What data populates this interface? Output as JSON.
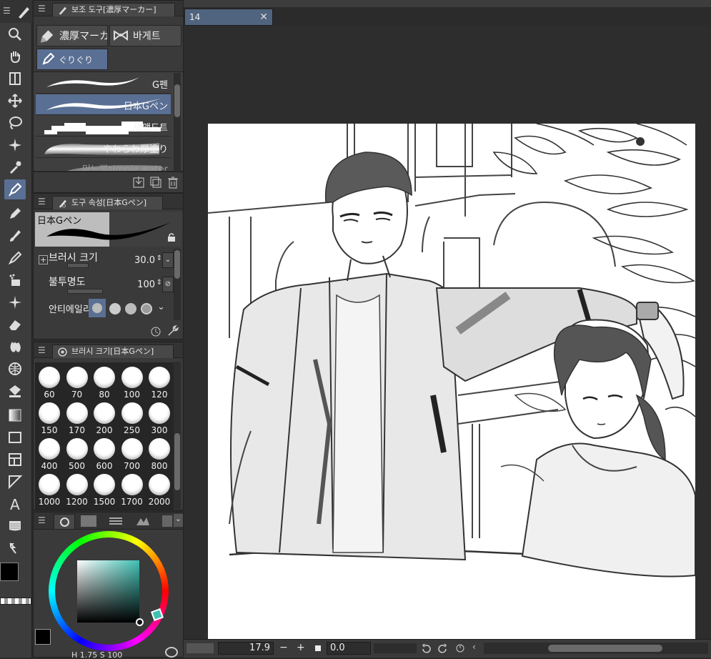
{
  "sub_tool_panel": {
    "title": "보조 도구[濃厚マーカー]",
    "tabs": [
      "濃厚マーカ",
      "바게트"
    ],
    "group_label": "ぐりぐり",
    "brushes": [
      {
        "label": "G펜"
      },
      {
        "label": "日本Gペン"
      },
      {
        "label": "맹맹도트"
      },
      {
        "label": "やわらわ厚塗り"
      },
      {
        "label": "머느뻘simple water"
      }
    ]
  },
  "tool_property_panel": {
    "title": "도구 속성[日本Gペン]",
    "preview_label": "日本Gペン",
    "brush_size_label": "브러시 크기",
    "brush_size_value": "30.0",
    "opacity_label": "불투명도",
    "opacity_value": "100",
    "antialias_label": "안티에일리"
  },
  "brush_size_panel": {
    "title": "브러시 크기[日本Gペン]",
    "sizes": [
      "60",
      "70",
      "80",
      "100",
      "120",
      "150",
      "170",
      "200",
      "250",
      "300",
      "400",
      "500",
      "600",
      "700",
      "800",
      "1000",
      "1200",
      "1500",
      "1700",
      "2000"
    ]
  },
  "color_panel": {
    "color_values": "1.75",
    "bottom_values": "100",
    "main_color": "#000000",
    "sub_color": "#ffffff",
    "selected_hue": "#3fc0b4"
  },
  "canvas": {
    "tab_label": "14",
    "close_label": "✕"
  },
  "statusbar": {
    "zoom": "17.9",
    "minus": "−",
    "plus": "+",
    "angle": "0.0"
  },
  "colors": {
    "accent": "#5a6f94",
    "panel": "#3a3a3a",
    "background": "#2b2b2b"
  }
}
